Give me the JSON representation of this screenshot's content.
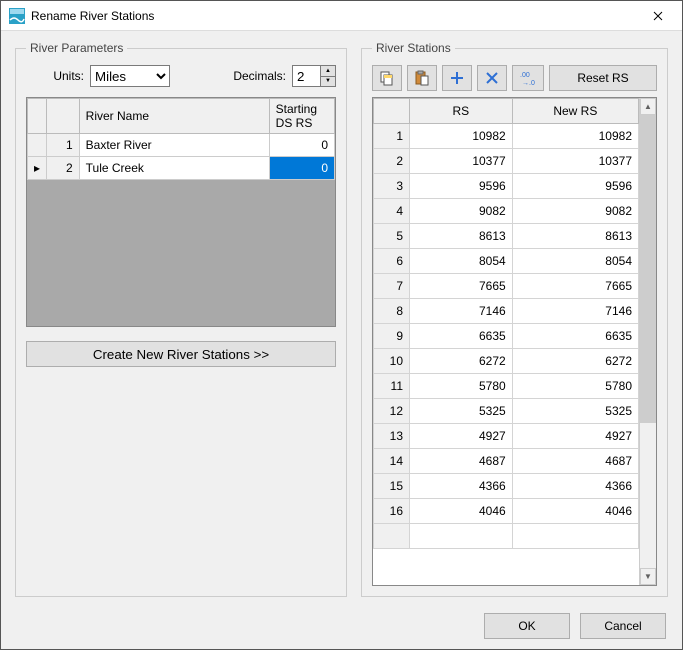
{
  "window": {
    "title": "Rename River Stations"
  },
  "left": {
    "legend": "River Parameters",
    "units_label": "Units:",
    "units_value": "Miles",
    "decimals_label": "Decimals:",
    "decimals_value": "2",
    "cols": {
      "rivername": "River Name",
      "ds": "Starting DS RS"
    },
    "rows": [
      {
        "n": "1",
        "name": "Baxter River",
        "ds": "0",
        "selected": false,
        "active": false
      },
      {
        "n": "2",
        "name": "Tule Creek",
        "ds": "0",
        "selected": true,
        "active": true
      }
    ],
    "create_btn": "Create New River Stations   >>"
  },
  "right": {
    "legend": "River Stations",
    "reset_btn": "Reset RS",
    "cols": {
      "rs": "RS",
      "newrs": "New RS"
    },
    "rows": [
      {
        "n": "1",
        "rs": "10982",
        "nr": "10982"
      },
      {
        "n": "2",
        "rs": "10377",
        "nr": "10377"
      },
      {
        "n": "3",
        "rs": "9596",
        "nr": "9596"
      },
      {
        "n": "4",
        "rs": "9082",
        "nr": "9082"
      },
      {
        "n": "5",
        "rs": "8613",
        "nr": "8613"
      },
      {
        "n": "6",
        "rs": "8054",
        "nr": "8054"
      },
      {
        "n": "7",
        "rs": "7665",
        "nr": "7665"
      },
      {
        "n": "8",
        "rs": "7146",
        "nr": "7146"
      },
      {
        "n": "9",
        "rs": "6635",
        "nr": "6635"
      },
      {
        "n": "10",
        "rs": "6272",
        "nr": "6272"
      },
      {
        "n": "11",
        "rs": "5780",
        "nr": "5780"
      },
      {
        "n": "12",
        "rs": "5325",
        "nr": "5325"
      },
      {
        "n": "13",
        "rs": "4927",
        "nr": "4927"
      },
      {
        "n": "14",
        "rs": "4687",
        "nr": "4687"
      },
      {
        "n": "15",
        "rs": "4366",
        "nr": "4366"
      },
      {
        "n": "16",
        "rs": "4046",
        "nr": "4046"
      }
    ]
  },
  "footer": {
    "ok": "OK",
    "cancel": "Cancel"
  }
}
